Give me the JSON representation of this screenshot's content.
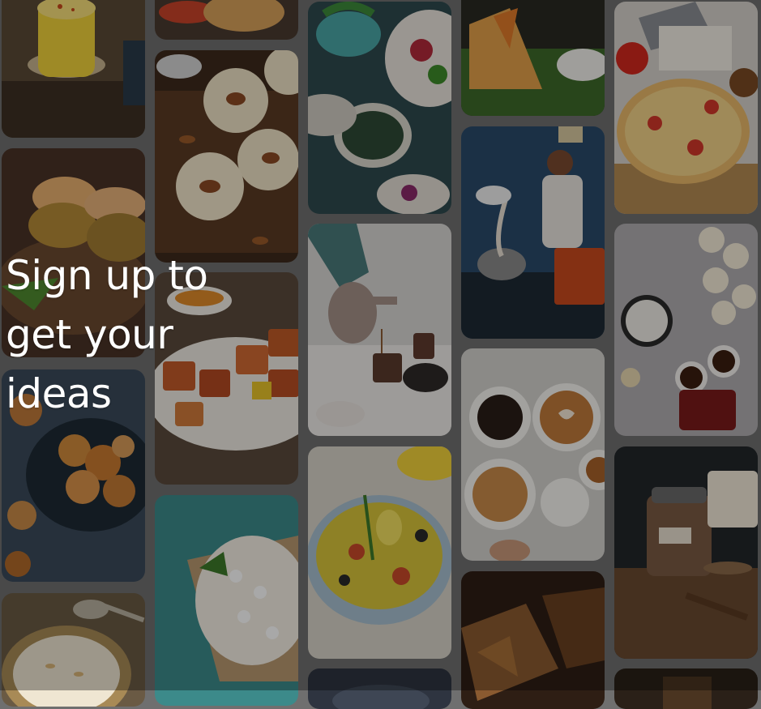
{
  "page": {
    "headline": "Sign up to get your ideas"
  },
  "tiles": [
    {
      "subject": "saffron-milk-glass"
    },
    {
      "subject": "vada-pav"
    },
    {
      "subject": "medu-vada"
    },
    {
      "subject": "rice-kheer"
    },
    {
      "subject": "fried-snack"
    },
    {
      "subject": "almond-cookies"
    },
    {
      "subject": "paneer-tikka"
    },
    {
      "subject": "bhel-puri-cone"
    },
    {
      "subject": "salad-bowls"
    },
    {
      "subject": "tea-pouring"
    },
    {
      "subject": "poha-bowl"
    },
    {
      "subject": "dark-plate"
    },
    {
      "subject": "samosa"
    },
    {
      "subject": "chai-vendor"
    },
    {
      "subject": "coffee-cups"
    },
    {
      "subject": "flatbread"
    },
    {
      "subject": "pizza-grater"
    },
    {
      "subject": "chai-spread"
    },
    {
      "subject": "spice-jar"
    },
    {
      "subject": "dark-food"
    }
  ],
  "colors": {
    "overlay": "rgba(0,0,0,0.34)",
    "headline": "#ffffff",
    "page_bg": "#6f6f6f"
  }
}
